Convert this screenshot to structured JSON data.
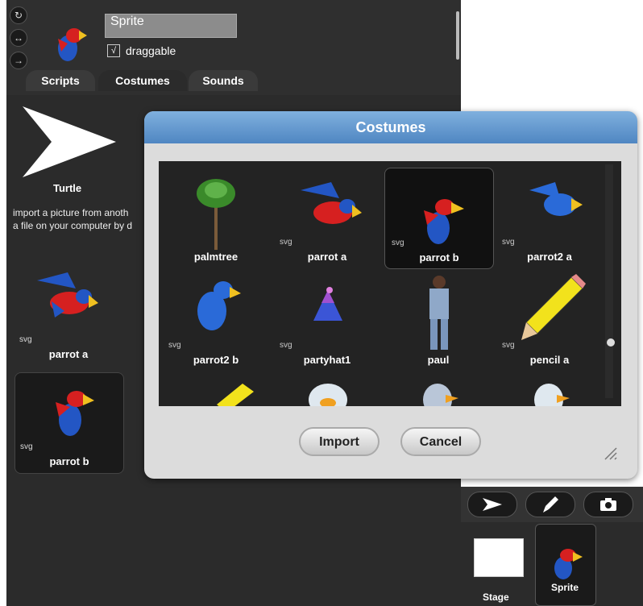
{
  "sprite": {
    "name": "Sprite",
    "draggable_label": "draggable",
    "draggable_checked": "√"
  },
  "tabs": [
    {
      "label": "Scripts"
    },
    {
      "label": "Costumes"
    },
    {
      "label": "Sounds"
    }
  ],
  "costumes_panel": {
    "turtle_label": "Turtle",
    "import_hint_line1": "import a picture from anoth",
    "import_hint_line2": "a file on your computer by d",
    "items": [
      {
        "tag": "svg",
        "name": "parrot a"
      },
      {
        "tag": "svg",
        "name": "parrot b"
      }
    ]
  },
  "dialog": {
    "title": "Costumes",
    "items": [
      {
        "name": "palmtree",
        "tag": "",
        "icon": "palmtree-icon"
      },
      {
        "name": "parrot a",
        "tag": "svg",
        "icon": "parrot-icon"
      },
      {
        "name": "parrot b",
        "tag": "svg",
        "icon": "parrot-icon",
        "selected": true
      },
      {
        "name": "parrot2 a",
        "tag": "svg",
        "icon": "parrot2-icon"
      },
      {
        "name": "parrot2 b",
        "tag": "svg",
        "icon": "parrot2-icon"
      },
      {
        "name": "partyhat1",
        "tag": "svg",
        "icon": "partyhat-icon"
      },
      {
        "name": "paul",
        "tag": "",
        "icon": "paul-icon"
      },
      {
        "name": "pencil a",
        "tag": "svg",
        "icon": "pencil-icon"
      }
    ],
    "import_label": "Import",
    "cancel_label": "Cancel"
  },
  "corral": {
    "stage_label": "Stage",
    "sprite_label": "Sprite"
  },
  "colors": {
    "dialog_title": "#5b91cb",
    "panel_bg": "#2b2b2b"
  }
}
